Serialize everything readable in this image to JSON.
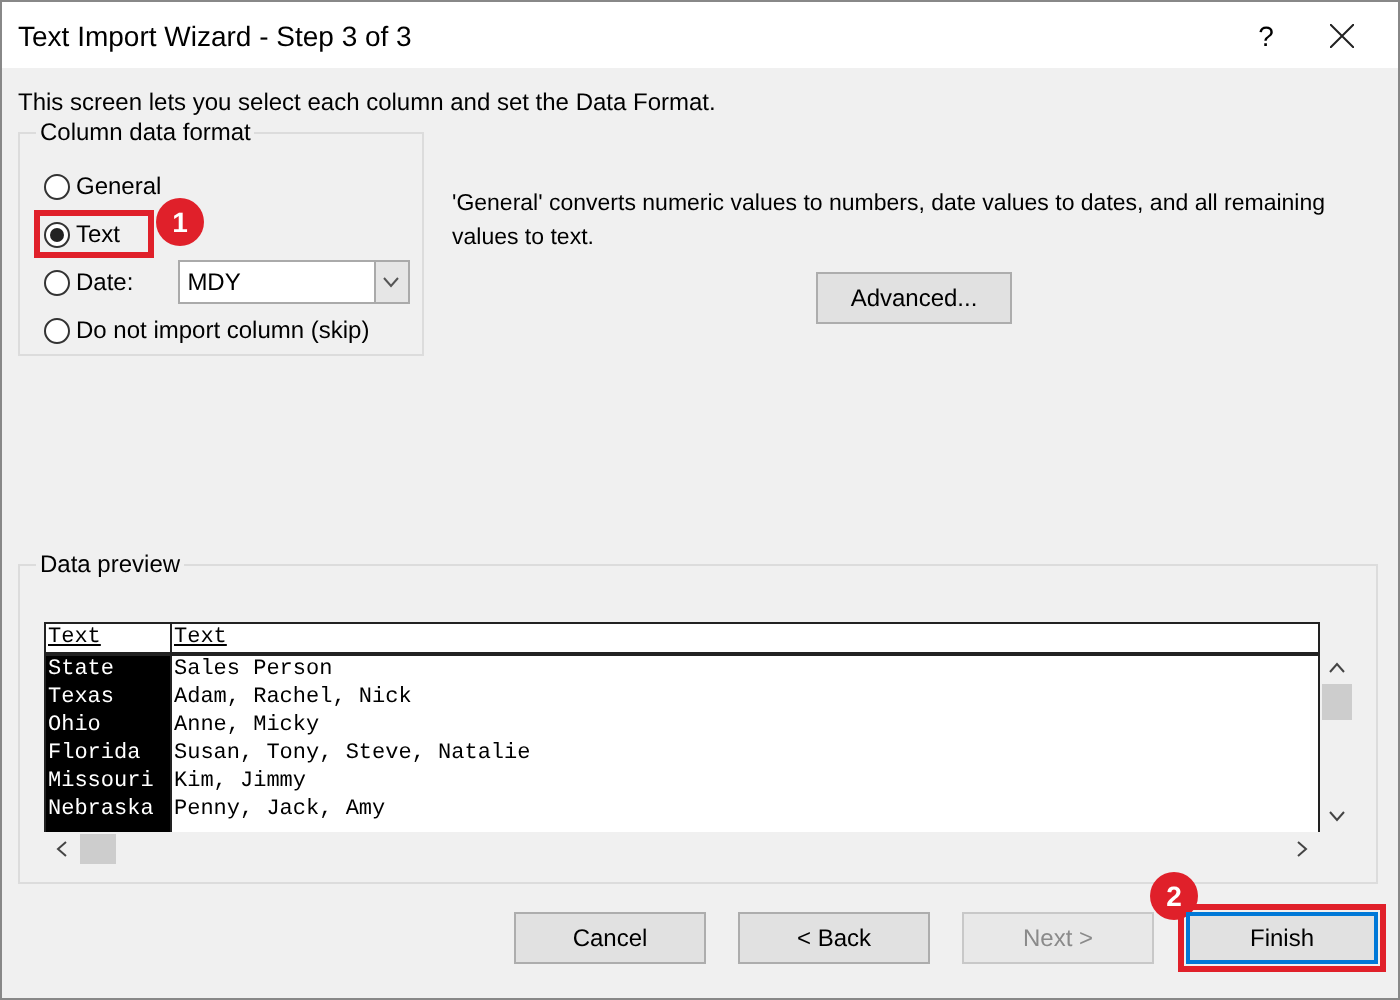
{
  "window": {
    "title": "Text Import Wizard - Step 3 of 3",
    "help": "?"
  },
  "intro": "This screen lets you select each column and set the Data Format.",
  "format_group": {
    "title": "Column data format",
    "options": [
      {
        "label": "General",
        "selected": false
      },
      {
        "label": "Text",
        "selected": true,
        "callout": "1"
      },
      {
        "label": "Date:",
        "selected": false,
        "dropdown": "MDY"
      },
      {
        "label": "Do not import column (skip)",
        "selected": false
      }
    ]
  },
  "description": "'General' converts numeric values to numbers, date values to dates, and all remaining values to text.",
  "advanced_button": "Advanced...",
  "preview": {
    "title": "Data preview",
    "columns": [
      {
        "header": "Text",
        "selected": true
      },
      {
        "header": "Text",
        "selected": false
      }
    ],
    "rows": [
      [
        "State",
        "Sales Person"
      ],
      [
        "Texas",
        "Adam, Rachel, Nick"
      ],
      [
        "Ohio",
        "Anne, Micky"
      ],
      [
        "Florida",
        "Susan, Tony, Steve, Natalie"
      ],
      [
        "Missouri",
        "Kim, Jimmy"
      ],
      [
        "Nebraska",
        "Penny, Jack, Amy"
      ]
    ]
  },
  "buttons": [
    {
      "label": "Cancel",
      "disabled": false,
      "default": false
    },
    {
      "label": "< Back",
      "disabled": false,
      "default": false
    },
    {
      "label": "Next >",
      "disabled": true,
      "default": false
    },
    {
      "label": "Finish",
      "disabled": false,
      "default": true,
      "callout": "2"
    }
  ]
}
